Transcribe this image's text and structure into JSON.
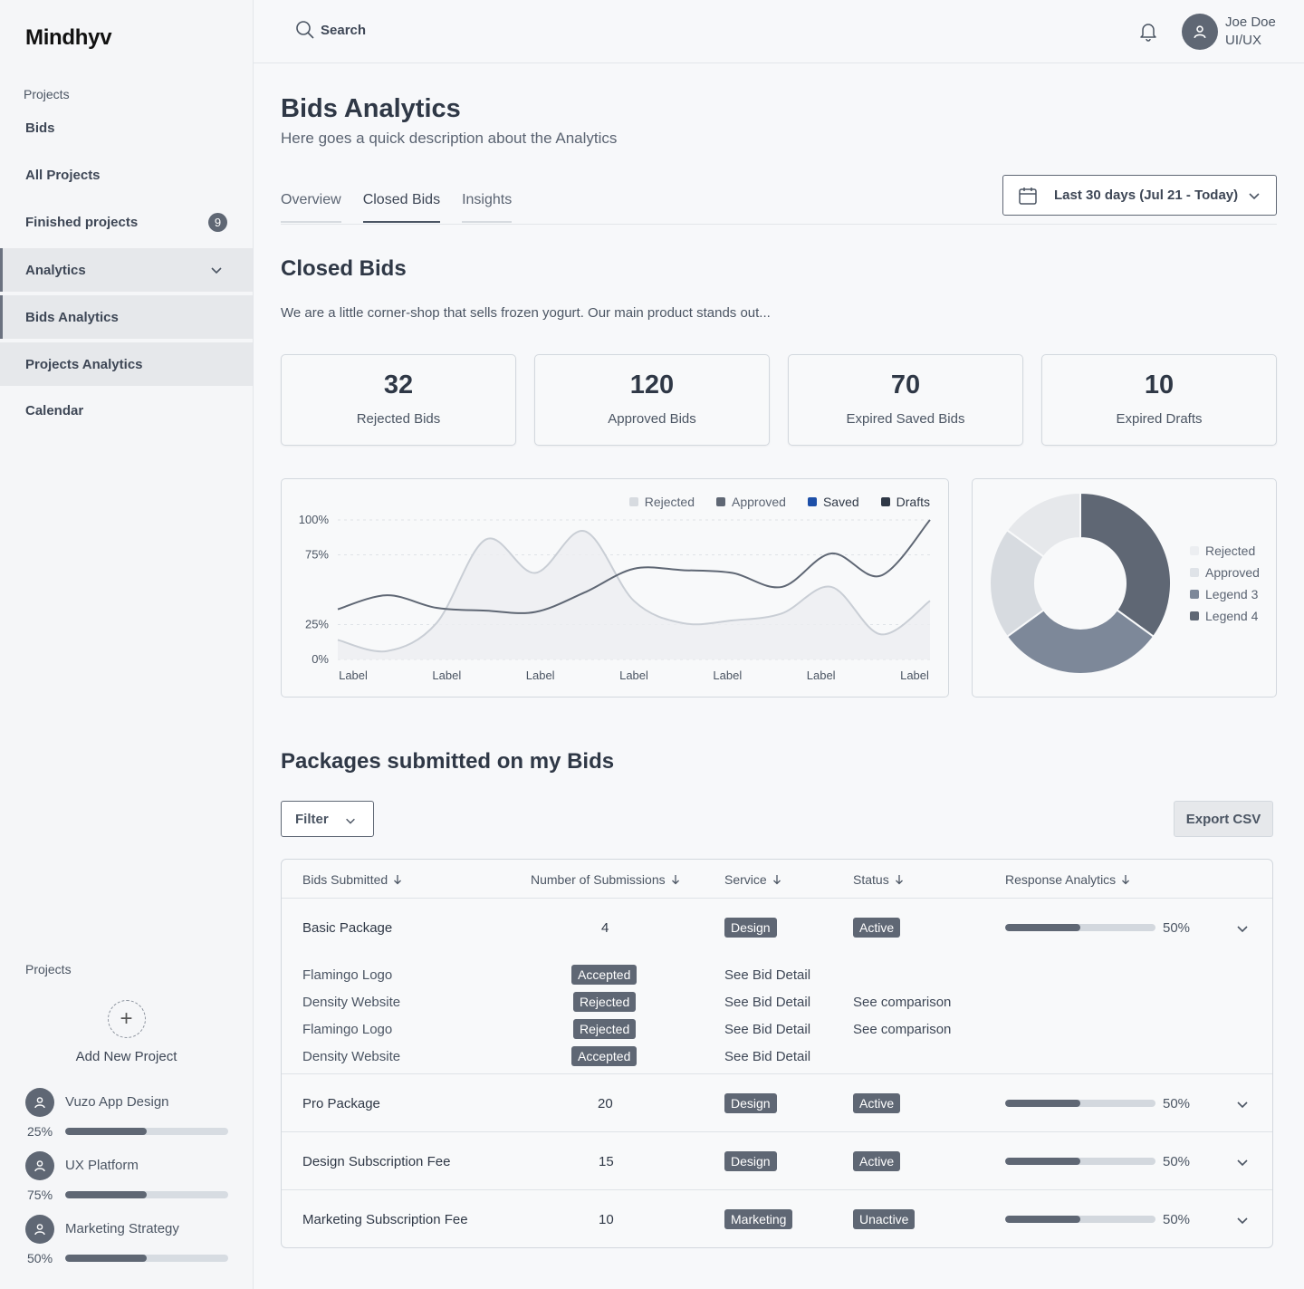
{
  "app": {
    "logo": "Mindhyv"
  },
  "sidebar": {
    "group_label": "Projects",
    "items": [
      {
        "label": "Bids"
      },
      {
        "label": "All Projects"
      },
      {
        "label": "Finished projects",
        "badge": "9"
      },
      {
        "label": "Analytics"
      },
      {
        "label": "Bids Analytics"
      },
      {
        "label": "Projects Analytics"
      },
      {
        "label": "Calendar"
      }
    ],
    "projects_label": "Projects",
    "add_project_label": "Add New Project",
    "projects": [
      {
        "name": "Vuzo App Design",
        "percent_label": "25%",
        "progress": 0.5
      },
      {
        "name": "UX Platform",
        "percent_label": "75%",
        "progress": 0.5
      },
      {
        "name": "Marketing Strategy",
        "percent_label": "50%",
        "progress": 0.5
      }
    ]
  },
  "header": {
    "search_placeholder": "Search",
    "user_name": "Joe Doe",
    "user_role": "UI/UX"
  },
  "page": {
    "title": "Bids Analytics",
    "description": "Here goes a quick description about  the Analytics",
    "tabs": [
      {
        "label": "Overview"
      },
      {
        "label": "Closed Bids"
      },
      {
        "label": "Insights"
      }
    ],
    "date_range": "Last 30 days (Jul 21 - Today)"
  },
  "closed_bids": {
    "title": "Closed Bids",
    "description": "We are a little corner-shop that sells frozen yogurt. Our main product stands out...",
    "stats": [
      {
        "value": "32",
        "label": "Rejected Bids"
      },
      {
        "value": "120",
        "label": "Approved Bids"
      },
      {
        "value": "70",
        "label": "Expired Saved Bids"
      },
      {
        "value": "10",
        "label": "Expired Drafts"
      }
    ]
  },
  "colors": {
    "accent": "#5f6774",
    "saved": "#1d4fa8",
    "drafts": "#2f3846"
  },
  "chart_data": [
    {
      "type": "line",
      "categories": [
        "Label",
        "Label",
        "Label",
        "Label",
        "Label",
        "Label",
        "Label"
      ],
      "y_ticks": [
        "100%",
        "75%",
        "25%",
        "0%"
      ],
      "ylim": [
        0,
        100
      ],
      "legend": [
        {
          "name": "Rejected",
          "color": "#d7dbe0"
        },
        {
          "name": "Approved",
          "color": "#5f6774"
        },
        {
          "name": "Saved",
          "color": "#1d4fa8"
        },
        {
          "name": "Drafts",
          "color": "#2f3846"
        }
      ],
      "series": [
        {
          "values": [
            14,
            6,
            26,
            86,
            62,
            92,
            42,
            26,
            28,
            33,
            52,
            18,
            42
          ]
        },
        {
          "values": [
            36,
            46,
            37,
            35,
            34,
            48,
            65,
            64,
            62,
            52,
            76,
            60,
            100
          ]
        }
      ]
    },
    {
      "type": "pie",
      "legend": [
        {
          "name": "Rejected",
          "color": "#eceef1"
        },
        {
          "name": "Approved",
          "color": "#dfe3e8"
        },
        {
          "name": "Legend 3",
          "color": "#7d8899"
        },
        {
          "name": "Legend 4",
          "color": "#5f6774"
        }
      ],
      "slices": [
        {
          "value": 35,
          "color": "#5f6774"
        },
        {
          "value": 30,
          "color": "#7d8899"
        },
        {
          "value": 20,
          "color": "#d7dbe0"
        },
        {
          "value": 15,
          "color": "#e6e8eb"
        }
      ]
    }
  ],
  "packages": {
    "title": "Packages submitted on my Bids",
    "filter_label": "Filter",
    "export_label": "Export CSV",
    "columns": [
      "Bids Submitted",
      "Number of Submissions",
      "Service",
      "Status",
      "Response Analytics"
    ],
    "rows": [
      {
        "name": "Basic Package",
        "count": "4",
        "service": "Design",
        "status": "Active",
        "percent_label": "50%",
        "progress": 0.5
      },
      {
        "name": "Pro Package",
        "count": "20",
        "service": "Design",
        "status": "Active",
        "percent_label": "50%",
        "progress": 0.5
      },
      {
        "name": "Design Subscription Fee",
        "count": "15",
        "service": "Design",
        "status": "Active",
        "percent_label": "50%",
        "progress": 0.5
      },
      {
        "name": "Marketing Subscription Fee",
        "count": "10",
        "service": "Marketing",
        "status": "Unactive",
        "percent_label": "50%",
        "progress": 0.5
      }
    ],
    "sub_rows": [
      {
        "name": "Flamingo Logo",
        "status": "Accepted",
        "detail": "See Bid Detail",
        "compare": ""
      },
      {
        "name": "Density Website",
        "status": "Rejected",
        "detail": "See Bid Detail",
        "compare": "See comparison"
      },
      {
        "name": "Flamingo Logo",
        "status": "Rejected",
        "detail": "See Bid Detail",
        "compare": "See comparison"
      },
      {
        "name": "Density Website",
        "status": "Accepted",
        "detail": "See Bid Detail",
        "compare": ""
      }
    ]
  }
}
